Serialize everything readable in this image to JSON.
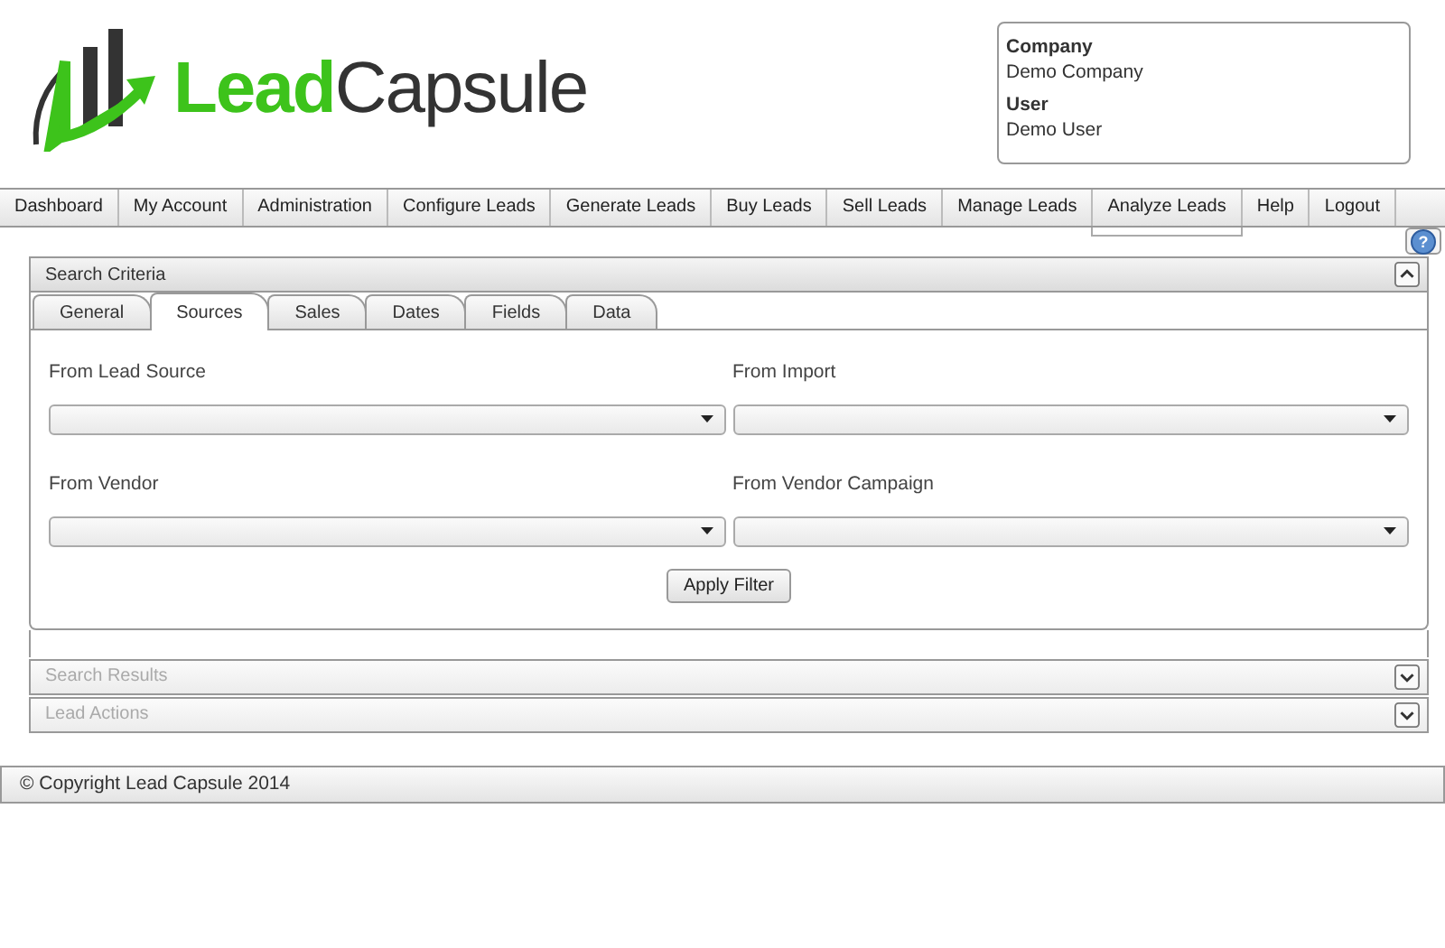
{
  "logo": {
    "text_1": "Lead",
    "text_2": "Capsule"
  },
  "account": [
    {
      "label": "Company",
      "value": "Demo Company"
    },
    {
      "label": "User",
      "value": "Demo User"
    }
  ],
  "menu": [
    {
      "label": "Dashboard",
      "expanded": false
    },
    {
      "label": "My Account",
      "expanded": false
    },
    {
      "label": "Administration",
      "expanded": false
    },
    {
      "label": "Configure Leads",
      "expanded": false
    },
    {
      "label": "Generate Leads",
      "expanded": false
    },
    {
      "label": "Buy Leads",
      "expanded": false
    },
    {
      "label": "Sell Leads",
      "expanded": false
    },
    {
      "label": "Manage Leads",
      "expanded": false
    },
    {
      "label": "Analyze Leads",
      "expanded": true
    },
    {
      "label": "Help",
      "expanded": false
    },
    {
      "label": "Logout",
      "expanded": false
    }
  ],
  "panels": [
    {
      "title": "Search Criteria",
      "expanded": true,
      "tabs": [
        {
          "label": "General",
          "selected": false
        },
        {
          "label": "Sources",
          "selected": true
        },
        {
          "label": "Sales",
          "selected": false
        },
        {
          "label": "Dates",
          "selected": false
        },
        {
          "label": "Fields",
          "selected": false
        },
        {
          "label": "Data",
          "selected": false
        }
      ],
      "fields": [
        {
          "label": "From Lead Source"
        },
        {
          "label": "From Import"
        },
        {
          "label": "From Vendor"
        },
        {
          "label": "From Vendor Campaign"
        }
      ],
      "button": "Apply Filter"
    },
    {
      "title": "Search Results",
      "expanded": false
    },
    {
      "title": "Lead Actions",
      "expanded": false
    }
  ],
  "help": "?",
  "footer": "© Copyright Lead Capsule 2014"
}
